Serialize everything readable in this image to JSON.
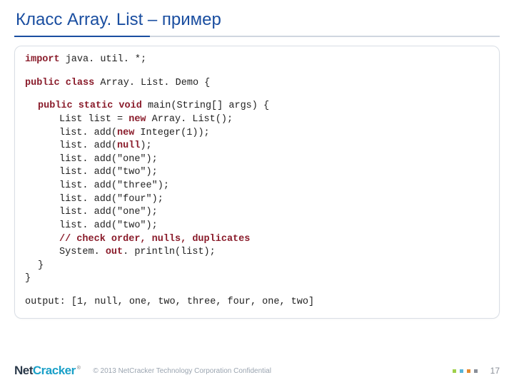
{
  "title": "Класс Array. List – пример",
  "code": {
    "l1a": "import",
    "l1b": " java. util. *;",
    "l2a": "public",
    "l2b": " class",
    "l2c": " Array. List. Demo {",
    "l3a": "public",
    "l3b": " static",
    "l3c": " void",
    "l3d": " main(String[] args) {",
    "l4a": "List list = ",
    "l4b": "new",
    "l4c": " Array. List();",
    "l5a": "list. add(",
    "l5b": "new",
    "l5c": " Integer(1));",
    "l6a": "list. add(",
    "l6b": "null",
    "l6c": ");",
    "l7": "list. add(\"one\");",
    "l8": "list. add(\"two\");",
    "l9": "list. add(\"three\");",
    "l10": "list. add(\"four\");",
    "l11": "list. add(\"one\");",
    "l12": "list. add(\"two\");",
    "l13": "// check order, nulls, duplicates",
    "l14a": "System. ",
    "l14b": "out",
    "l14c": ". println(list);",
    "l15": "}",
    "l16": "}",
    "out": "output: [1, null, one, two, three, four, one, two]"
  },
  "footer": {
    "logo_a": "Net",
    "logo_b": "Cracker",
    "tm": "®",
    "copyright": "© 2013 NetCracker Technology Corporation Confidential",
    "page": "17"
  }
}
